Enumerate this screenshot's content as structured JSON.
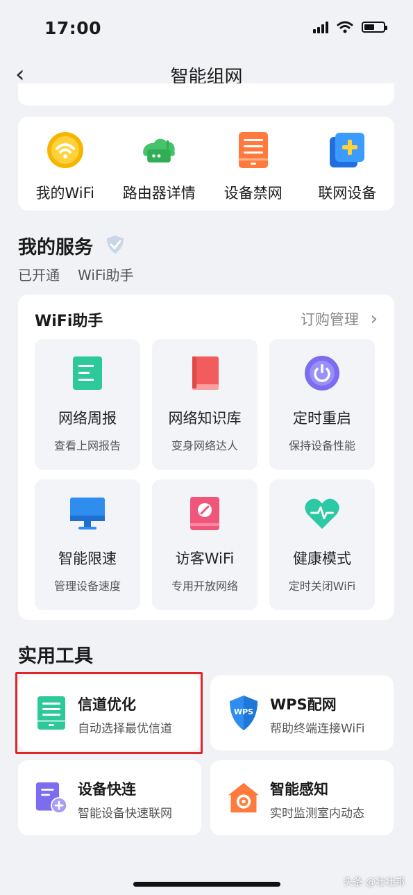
{
  "status": {
    "time": "17:00"
  },
  "nav": {
    "back_glyph": "‹",
    "title": "智能组网"
  },
  "quick": [
    {
      "label": "我的WiFi",
      "icon": "wifi-coin-icon"
    },
    {
      "label": "路由器详情",
      "icon": "router-icon"
    },
    {
      "label": "设备禁网",
      "icon": "device-block-icon"
    },
    {
      "label": "联网设备",
      "icon": "add-device-icon"
    }
  ],
  "services": {
    "title": "我的服务",
    "verified_icon": "verified-shield-icon",
    "opened_label": "已开通",
    "opened_value": "WiFi助手"
  },
  "assistant": {
    "title": "WiFi助手",
    "manage": "订购管理",
    "manage_arrow": "›",
    "tiles": [
      {
        "title": "网络周报",
        "sub": "查看上网报告",
        "icon": "report-icon"
      },
      {
        "title": "网络知识库",
        "sub": "变身网络达人",
        "icon": "book-icon"
      },
      {
        "title": "定时重启",
        "sub": "保持设备性能",
        "icon": "power-icon"
      },
      {
        "title": "智能限速",
        "sub": "管理设备速度",
        "icon": "monitor-icon"
      },
      {
        "title": "访客WiFi",
        "sub": "专用开放网络",
        "icon": "guest-icon"
      },
      {
        "title": "健康模式",
        "sub": "定时关闭WiFi",
        "icon": "heart-pulse-icon"
      }
    ]
  },
  "tools": {
    "title": "实用工具",
    "items": [
      {
        "title": "信道优化",
        "sub": "自动选择最优信道",
        "icon": "channel-optimize-icon"
      },
      {
        "title": "WPS配网",
        "sub": "帮助终端连接WiFi",
        "icon": "wps-shield-icon",
        "icon_text": "WPS"
      },
      {
        "title": "设备快连",
        "sub": "智能设备快速联网",
        "icon": "quick-connect-icon"
      },
      {
        "title": "智能感知",
        "sub": "实时监测室内动态",
        "icon": "home-sense-icon"
      }
    ]
  },
  "watermark": "头条 @壮壮邦",
  "colors": {
    "highlight": "#e0262b",
    "teal": "#2dc99a",
    "red": "#f25c5c",
    "purple": "#7b6cf0",
    "blue": "#2f8df0",
    "orange": "#ff7a3c"
  }
}
